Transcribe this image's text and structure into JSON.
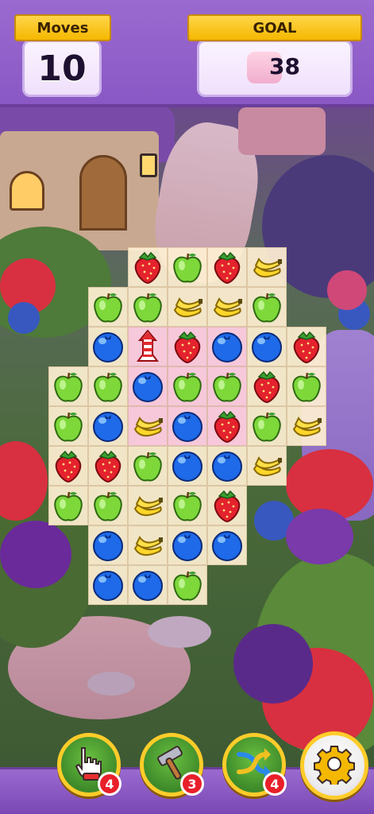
{
  "hud": {
    "moves_label": "Moves",
    "moves_value": "10",
    "goal_label": "GOAL",
    "goal_value": "38"
  },
  "board": {
    "rows": [
      [
        null,
        null,
        "strawberry",
        "apple",
        "strawberry",
        "banana",
        null
      ],
      [
        null,
        "apple",
        "apple",
        "banana",
        "banana",
        "apple",
        null
      ],
      [
        null,
        "blueberry",
        "rocket",
        "strawberry",
        "blueberry",
        "blueberry",
        "strawberry"
      ],
      [
        "apple",
        "apple",
        "blueberry",
        "apple",
        "apple",
        "strawberry",
        "apple"
      ],
      [
        "apple",
        "blueberry",
        "banana",
        "blueberry",
        "strawberry",
        "apple",
        "banana"
      ],
      [
        "strawberry",
        "strawberry",
        "apple",
        "blueberry",
        "blueberry",
        "banana",
        null
      ],
      [
        "apple",
        "apple",
        "banana",
        "apple",
        "strawberry",
        null,
        null
      ],
      [
        null,
        "blueberry",
        "banana",
        "blueberry",
        "blueberry",
        null,
        null
      ],
      [
        null,
        "blueberry",
        "blueberry",
        "apple",
        null,
        null,
        null
      ]
    ],
    "highlighted_cells": [
      [
        2,
        2
      ],
      [
        2,
        3
      ],
      [
        2,
        4
      ],
      [
        3,
        2
      ],
      [
        3,
        3
      ],
      [
        3,
        4
      ],
      [
        4,
        2
      ],
      [
        4,
        3
      ],
      [
        4,
        4
      ]
    ]
  },
  "boosters": [
    {
      "name": "hand-booster",
      "icon": "tap-hand-icon",
      "count": "4"
    },
    {
      "name": "hammer-booster",
      "icon": "hammer-icon",
      "count": "3"
    },
    {
      "name": "shuffle-booster",
      "icon": "shuffle-icon",
      "count": "4"
    }
  ],
  "settings_icon": "gear-icon",
  "colors": {
    "hud_purple": "#9a6ad0",
    "banner_gold": "#ffd54a",
    "badge_red": "#e8202a"
  }
}
